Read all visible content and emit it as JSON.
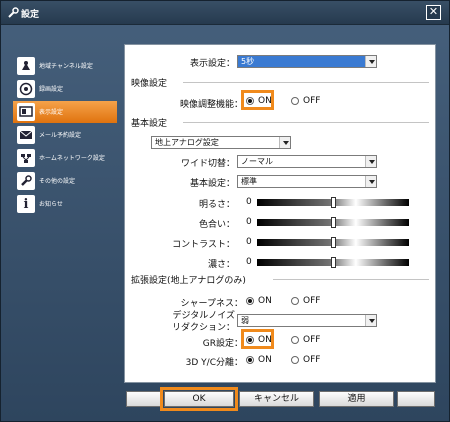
{
  "window": {
    "title": "設定"
  },
  "sidebar": {
    "items": [
      {
        "label": "地域チャンネル設定",
        "icon": "broadcast-icon",
        "active": false
      },
      {
        "label": "録画設定",
        "icon": "record-icon",
        "active": false
      },
      {
        "label": "表示設定",
        "icon": "display-icon",
        "active": true
      },
      {
        "label": "メール予約設定",
        "icon": "mail-icon",
        "active": false
      },
      {
        "label": "ホームネットワーク設定",
        "icon": "network-icon",
        "active": false
      },
      {
        "label": "その他の設定",
        "icon": "wrench-icon",
        "active": false
      },
      {
        "label": "お知らせ",
        "icon": "info-icon",
        "active": false
      }
    ]
  },
  "display": {
    "label": "表示設定：",
    "value": "5秒"
  },
  "video": {
    "section": "映像設定",
    "adjust_label": "映像調整機能：",
    "on": "ON",
    "off": "OFF",
    "selected": "ON"
  },
  "basic": {
    "section": "基本設定",
    "source": "地上アナログ設定",
    "wide_label": "ワイド切替：",
    "wide_value": "ノーマル",
    "basic_label": "基本設定：",
    "basic_value": "標準",
    "sliders": [
      {
        "label": "明るさ：",
        "value": "0",
        "level": 0.5
      },
      {
        "label": "色合い：",
        "value": "0",
        "level": 0.5
      },
      {
        "label": "コントラスト：",
        "value": "0",
        "level": 0.5
      },
      {
        "label": "濃さ：",
        "value": "0",
        "level": 0.5
      }
    ]
  },
  "extended": {
    "section": "拡張設定(地上アナログのみ)",
    "sharpness_label": "シャープネス：",
    "noise_label_1": "デジタルノイズ",
    "noise_label_2": "リダクション：",
    "noise_value": "弱",
    "gr_label": "GR設定：",
    "yc_label": "3D Y/C分離：",
    "on": "ON",
    "off": "OFF"
  },
  "buttons": {
    "ok": "OK",
    "cancel": "キャンセル",
    "apply": "適用"
  },
  "colors": {
    "accent": "#f08a1c",
    "window_bg": "#3a526b",
    "highlight": "#3a7ad2"
  }
}
